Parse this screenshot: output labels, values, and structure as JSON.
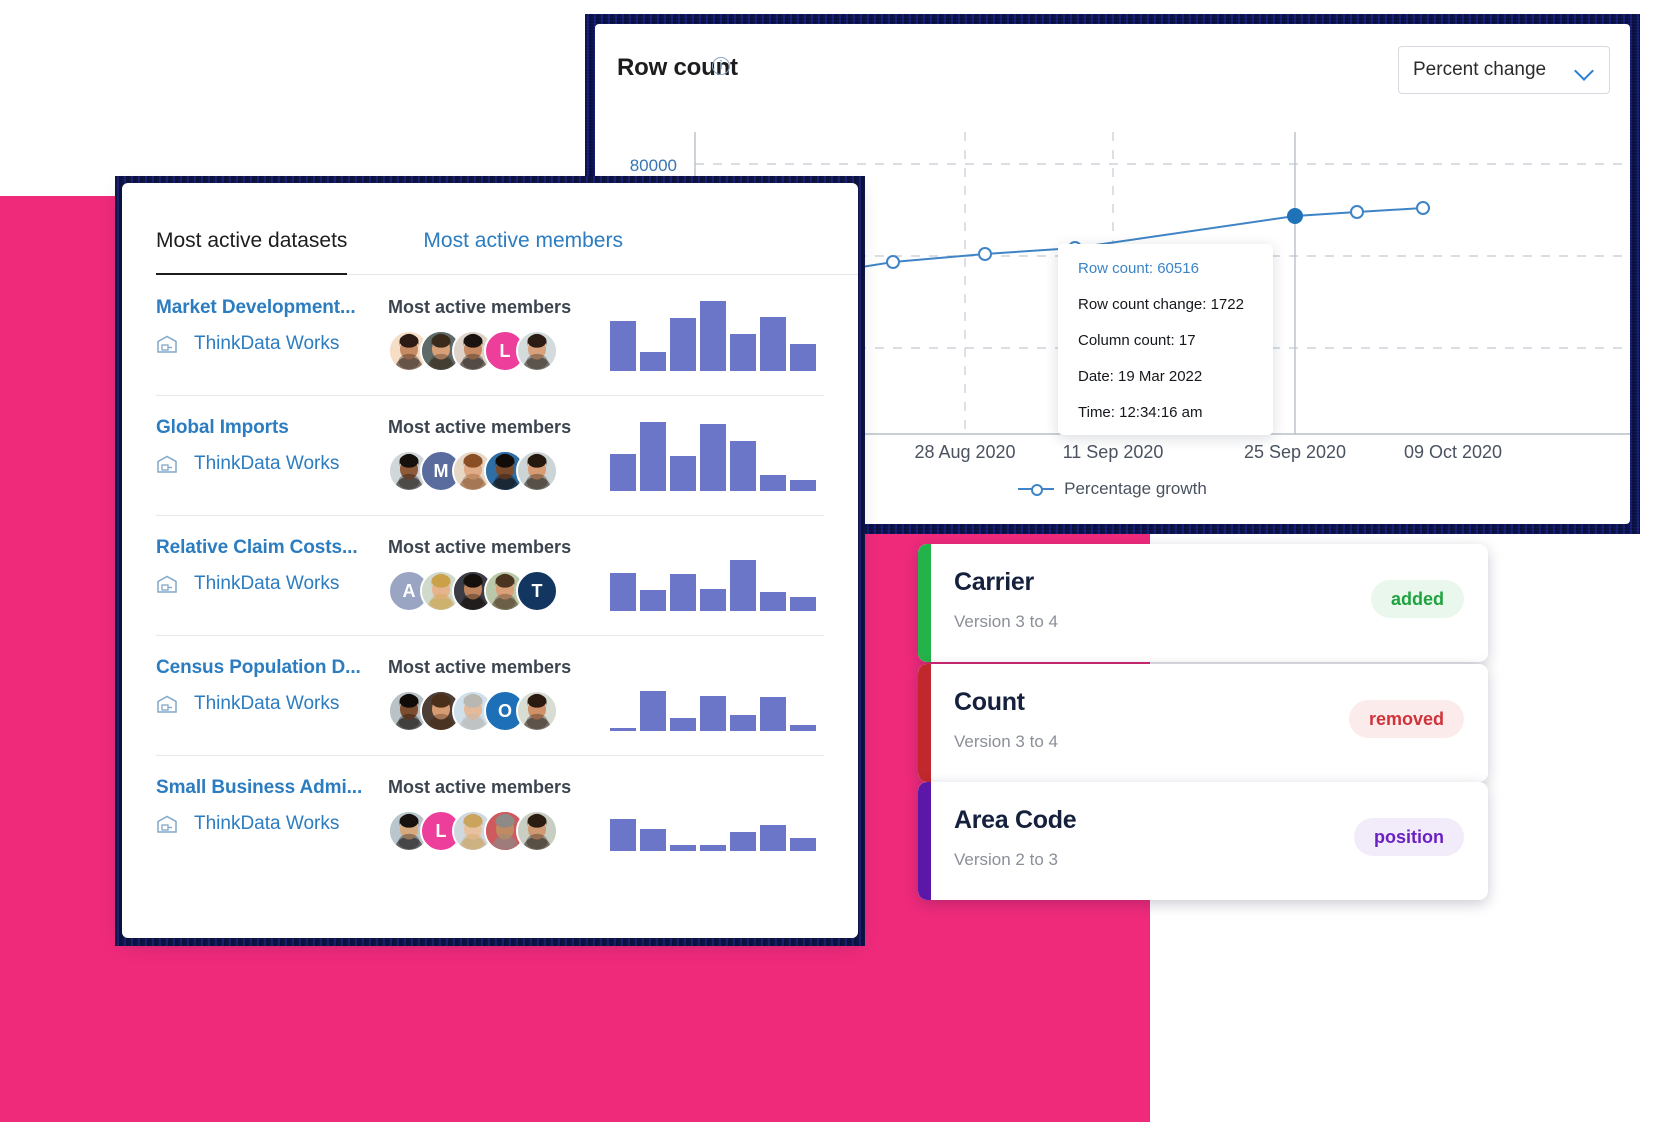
{
  "chart_card": {
    "title": "Row count",
    "info_icon": "info-icon",
    "select": {
      "value": "Percent change",
      "chevron": "chevron-down-icon"
    },
    "tooltip": {
      "row_count": "Row count: 60516",
      "row_count_change": "Row count change: 1722",
      "column_count": "Column count: 17",
      "date": "Date: 19 Mar 2022",
      "time": "Time: 12:34:16 am"
    },
    "legend_label": "Percentage growth"
  },
  "chart_data": {
    "type": "line",
    "title": "Row count",
    "xlabel": "",
    "ylabel": "",
    "ylim": [
      0,
      100000
    ],
    "yticks": [
      80000
    ],
    "ytick_labels": [
      "80000"
    ],
    "grid": true,
    "legend_position": "bottom",
    "x": [
      "28 Aug 2020",
      "11 Sep 2020",
      "25 Sep 2020",
      "09 Oct 2020"
    ],
    "xtick_labels": [
      "28 Aug 2020",
      "11 Sep 2020",
      "25 Sep 2020",
      "09 Oct 2020"
    ],
    "series": [
      {
        "name": "Percentage growth",
        "color": "#3f84c6",
        "points": [
          {
            "x": 0.0,
            "y": 55200
          },
          {
            "x": 0.28,
            "y": 56900
          },
          {
            "x": 0.5,
            "y": 58100
          },
          {
            "x": 0.72,
            "y": 58800
          },
          {
            "x": 0.94,
            "y": 60516
          },
          {
            "x": 1.16,
            "y": 61900
          },
          {
            "x": 1.36,
            "y": 62700
          }
        ],
        "highlighted_point_index": 4
      }
    ],
    "highlight": {
      "row_count": 60516,
      "row_count_change": 1722,
      "column_count": 17,
      "date": "19 Mar 2022",
      "time": "12:34:16 am"
    }
  },
  "datasets_card": {
    "tabs": [
      {
        "label": "Most active datasets",
        "active": true
      },
      {
        "label": "Most active members",
        "active": false
      }
    ],
    "members_heading": "Most active members",
    "rows": [
      {
        "title": "Market Development...",
        "org": "ThinkData Works",
        "org_icon": "warehouse-icon",
        "members_heading": "Most active members",
        "avatars": [
          {
            "type": "photo",
            "skin": "#c58b63",
            "hair": "#2b1b14",
            "bg": "#f6ddc6"
          },
          {
            "type": "photo",
            "skin": "#d8a077",
            "hair": "#3a2a1c",
            "bg": "#5d6a68"
          },
          {
            "type": "photo",
            "skin": "#c78a62",
            "hair": "#1b1310",
            "bg": "#ded3c8"
          },
          {
            "type": "initial",
            "letter": "L",
            "bg": "#ec3e9a"
          },
          {
            "type": "photo",
            "skin": "#d8a27c",
            "hair": "#2c1d14",
            "bg": "#d3dbdc"
          }
        ],
        "sparkline": [
          62,
          24,
          66,
          88,
          46,
          68,
          34
        ]
      },
      {
        "title": "Global Imports",
        "org": "ThinkData Works",
        "org_icon": "warehouse-icon",
        "members_heading": "Most active members",
        "avatars": [
          {
            "type": "photo",
            "skin": "#8d5a3a",
            "hair": "#16100c",
            "bg": "#cfd7da"
          },
          {
            "type": "initial",
            "letter": "M",
            "bg": "#5a6b9e"
          },
          {
            "type": "photo",
            "skin": "#e0ab85",
            "hair": "#8a4f24",
            "bg": "#e6d8c6"
          },
          {
            "type": "photo",
            "skin": "#7a4a2d",
            "hair": "#120c08",
            "bg": "#2f6ea5"
          },
          {
            "type": "photo",
            "skin": "#d79c74",
            "hair": "#25190f",
            "bg": "#cdd4d6"
          }
        ],
        "sparkline": [
          46,
          86,
          44,
          84,
          62,
          20,
          14
        ]
      },
      {
        "title": "Relative Claim Costs...",
        "org": "ThinkData Works",
        "org_icon": "warehouse-icon",
        "members_heading": "Most active members",
        "avatars": [
          {
            "type": "initial",
            "letter": "A",
            "bg": "#9aa5c4"
          },
          {
            "type": "photo",
            "skin": "#e5b48c",
            "hair": "#caa049",
            "bg": "#cfd9cc"
          },
          {
            "type": "photo",
            "skin": "#c0845c",
            "hair": "#15100c",
            "bg": "#3c3c46"
          },
          {
            "type": "photo",
            "skin": "#d9a079",
            "hair": "#4b3420",
            "bg": "#bac7a9"
          },
          {
            "type": "initial",
            "letter": "T",
            "bg": "#12365f"
          }
        ],
        "sparkline": [
          48,
          26,
          46,
          28,
          64,
          24,
          18
        ]
      },
      {
        "title": "Census Population D...",
        "org": "ThinkData Works",
        "org_icon": "warehouse-icon",
        "members_heading": "Most active members",
        "avatars": [
          {
            "type": "photo",
            "skin": "#7d4d2f",
            "hair": "#110b08",
            "bg": "#b9c2c6"
          },
          {
            "type": "photo",
            "skin": "#d79b72",
            "hair": "#4a2f1b",
            "bg": "#4d3f36"
          },
          {
            "type": "photo",
            "skin": "#e3bb9b",
            "hair": "#b9b7b2",
            "bg": "#cfe0ea"
          },
          {
            "type": "initial",
            "letter": "O",
            "bg": "#1d6fb8"
          },
          {
            "type": "photo",
            "skin": "#cf9168",
            "hair": "#2a1a10",
            "bg": "#d8ddd4"
          }
        ],
        "sparkline": [
          4,
          50,
          16,
          44,
          20,
          42,
          8
        ]
      },
      {
        "title": "Small Business Admi...",
        "org": "ThinkData Works",
        "org_icon": "warehouse-icon",
        "members_heading": "Most active members",
        "avatars": [
          {
            "type": "photo",
            "skin": "#d7a97f",
            "hair": "#171110",
            "bg": "#b9c6cd"
          },
          {
            "type": "initial",
            "letter": "L",
            "bg": "#ec3e9a"
          },
          {
            "type": "photo",
            "skin": "#e8c2a0",
            "hair": "#caa35c",
            "bg": "#cfd8de"
          },
          {
            "type": "photo",
            "skin": "#c08a62",
            "hair": "#8d8a88",
            "bg": "#cf5a5e"
          },
          {
            "type": "photo",
            "skin": "#cf9a72",
            "hair": "#2b1c12",
            "bg": "#c8cec2"
          }
        ],
        "sparkline": [
          40,
          28,
          8,
          8,
          24,
          32,
          16
        ]
      }
    ]
  },
  "version_cards": [
    {
      "title": "Carrier",
      "subtitle": "Version 3 to 4",
      "badge": "added",
      "stripe_color": "#23b34a",
      "badge_bg": "#eaf7ed",
      "badge_color": "#1ea33f"
    },
    {
      "title": "Count",
      "subtitle": "Version 3 to 4",
      "badge": "removed",
      "stripe_color": "#c1282d",
      "badge_bg": "#fbebeb",
      "badge_color": "#d0333a"
    },
    {
      "title": "Area Code",
      "subtitle": "Version 2 to 3",
      "badge": "position",
      "stripe_color": "#5b17a8",
      "badge_bg": "#f1ebfa",
      "badge_color": "#6b21c2"
    }
  ],
  "colors": {
    "magenta": "#ef2a7b",
    "chart_line": "#3f84c6",
    "bar": "#6b76c8",
    "link": "#2b7cc0"
  }
}
